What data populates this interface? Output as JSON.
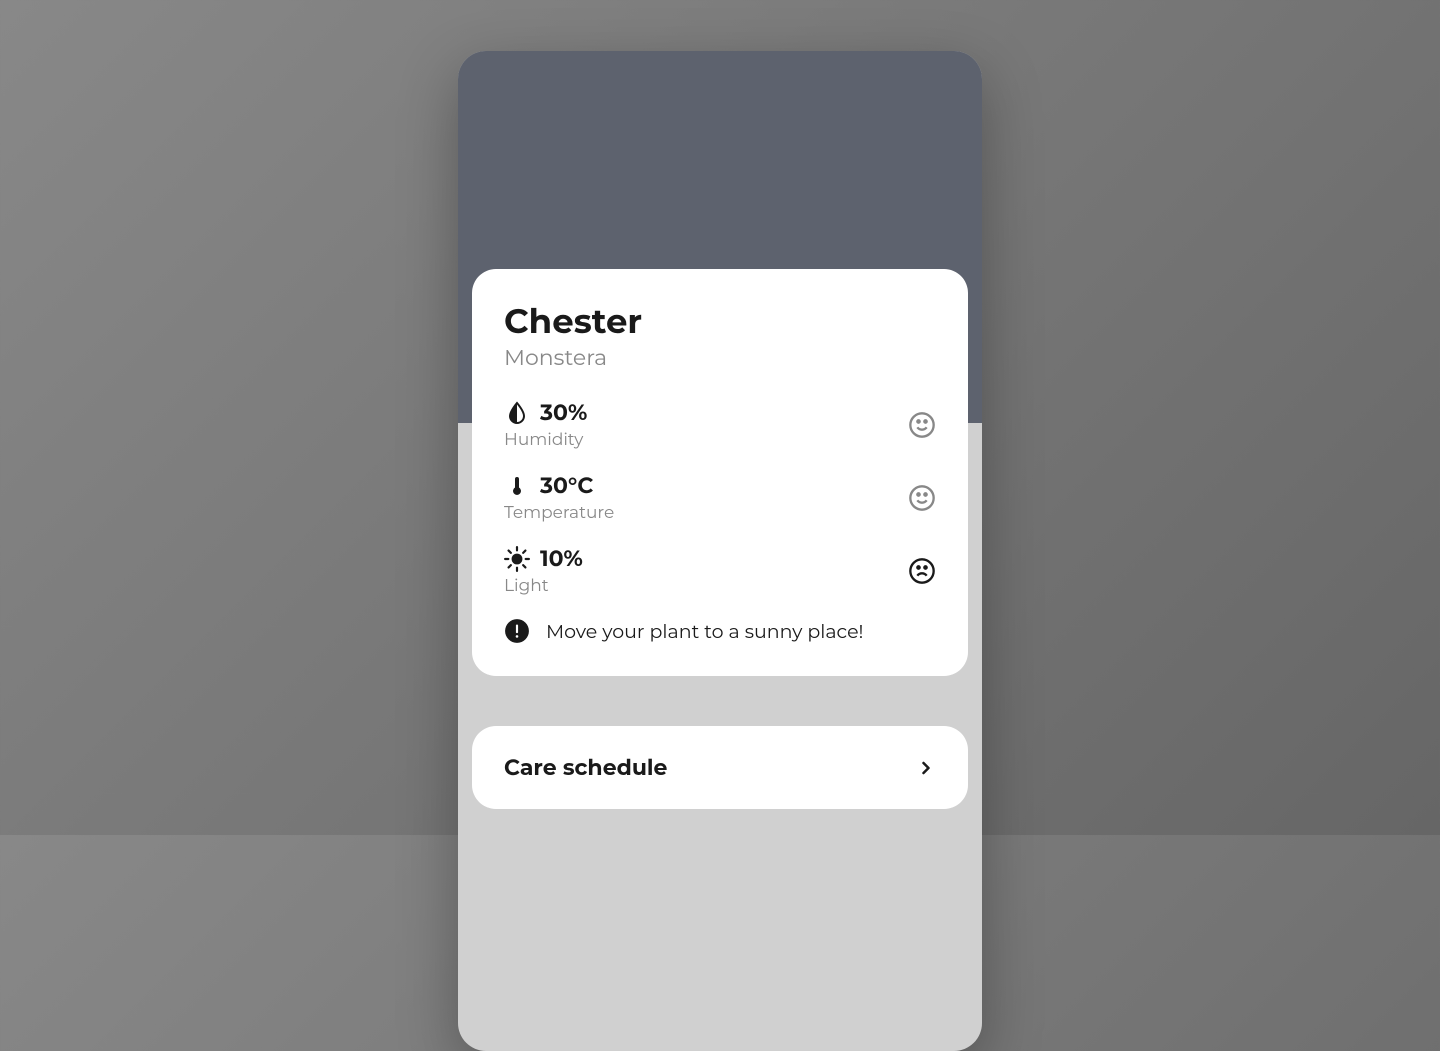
{
  "plant": {
    "name": "Chester",
    "type": "Monstera"
  },
  "metrics": [
    {
      "icon": "droplet",
      "value": "30%",
      "label": "Humidity",
      "status": "happy"
    },
    {
      "icon": "thermometer",
      "value": "30°C",
      "label": "Temperature",
      "status": "happy"
    },
    {
      "icon": "sun",
      "value": "10%",
      "label": "Light",
      "status": "sad"
    }
  ],
  "alert": {
    "text": "Move your plant to a sunny place!"
  },
  "schedule": {
    "title": "Care schedule"
  }
}
